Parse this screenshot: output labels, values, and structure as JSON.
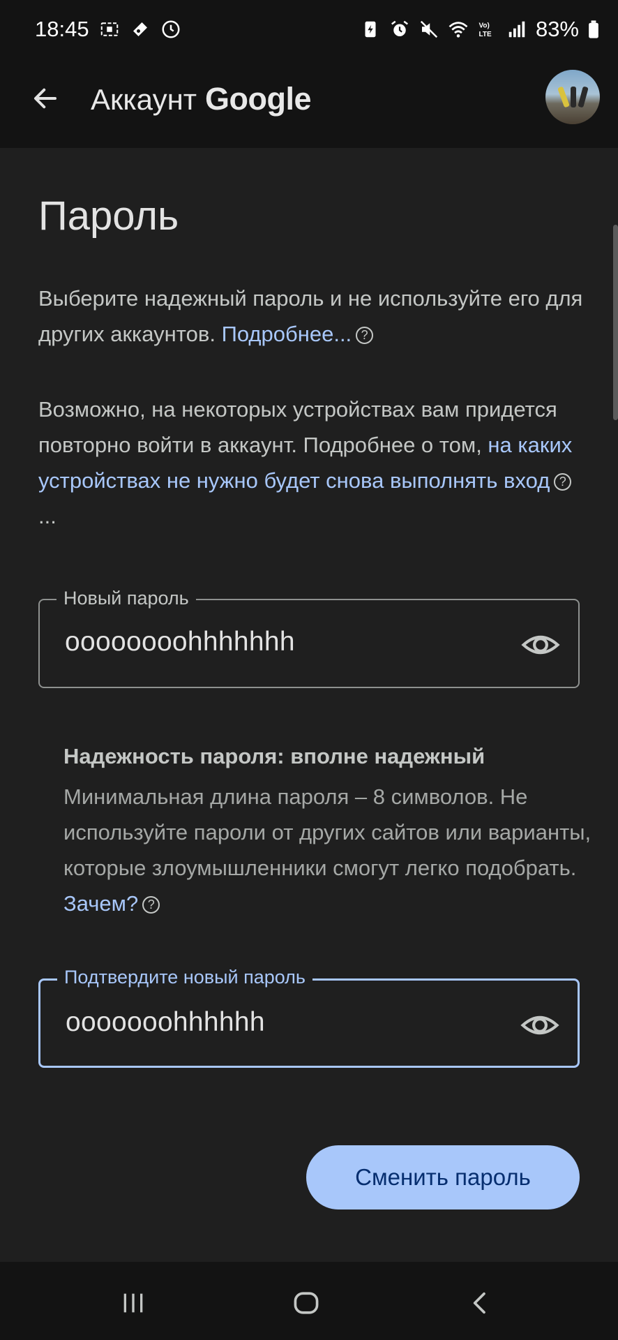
{
  "status_bar": {
    "time": "18:45",
    "battery": "83%"
  },
  "header": {
    "title_prefix": "Аккаунт",
    "title_brand": "Google"
  },
  "page": {
    "title": "Пароль",
    "para1_text": "Выберите надежный пароль и не используйте его для других аккаунтов. ",
    "para1_link": "Подробнее...",
    "para2_text": "Возможно, на некоторых устройствах вам придется повторно войти в аккаунт. Подроб­нее о том, ",
    "para2_link": "на каких устройствах не нужно бу­дет снова выполнять вход",
    "para2_suffix": "..."
  },
  "new_password": {
    "label": "Новый пароль",
    "value": "oooooooohhhhhhh"
  },
  "strength": {
    "title": "Надежность пароля: вполне надежный",
    "text": "Минимальная длина пароля – 8 символов. Не используйте пароли от других сайтов или варианты, которые злоумышленники смогут легко подобрать. ",
    "link": "Зачем?"
  },
  "confirm_password": {
    "label": "Подтвердите новый пароль",
    "value": "ooooooohhhhhh"
  },
  "actions": {
    "change_label": "Сменить пароль"
  },
  "colors": {
    "background": "#1f1f1f",
    "accent": "#a8c7fa",
    "button_text": "#062e6f"
  },
  "icons": [
    "back-arrow-icon",
    "eye-icon",
    "help-icon",
    "recent-apps-icon",
    "home-icon",
    "nav-back-icon"
  ]
}
